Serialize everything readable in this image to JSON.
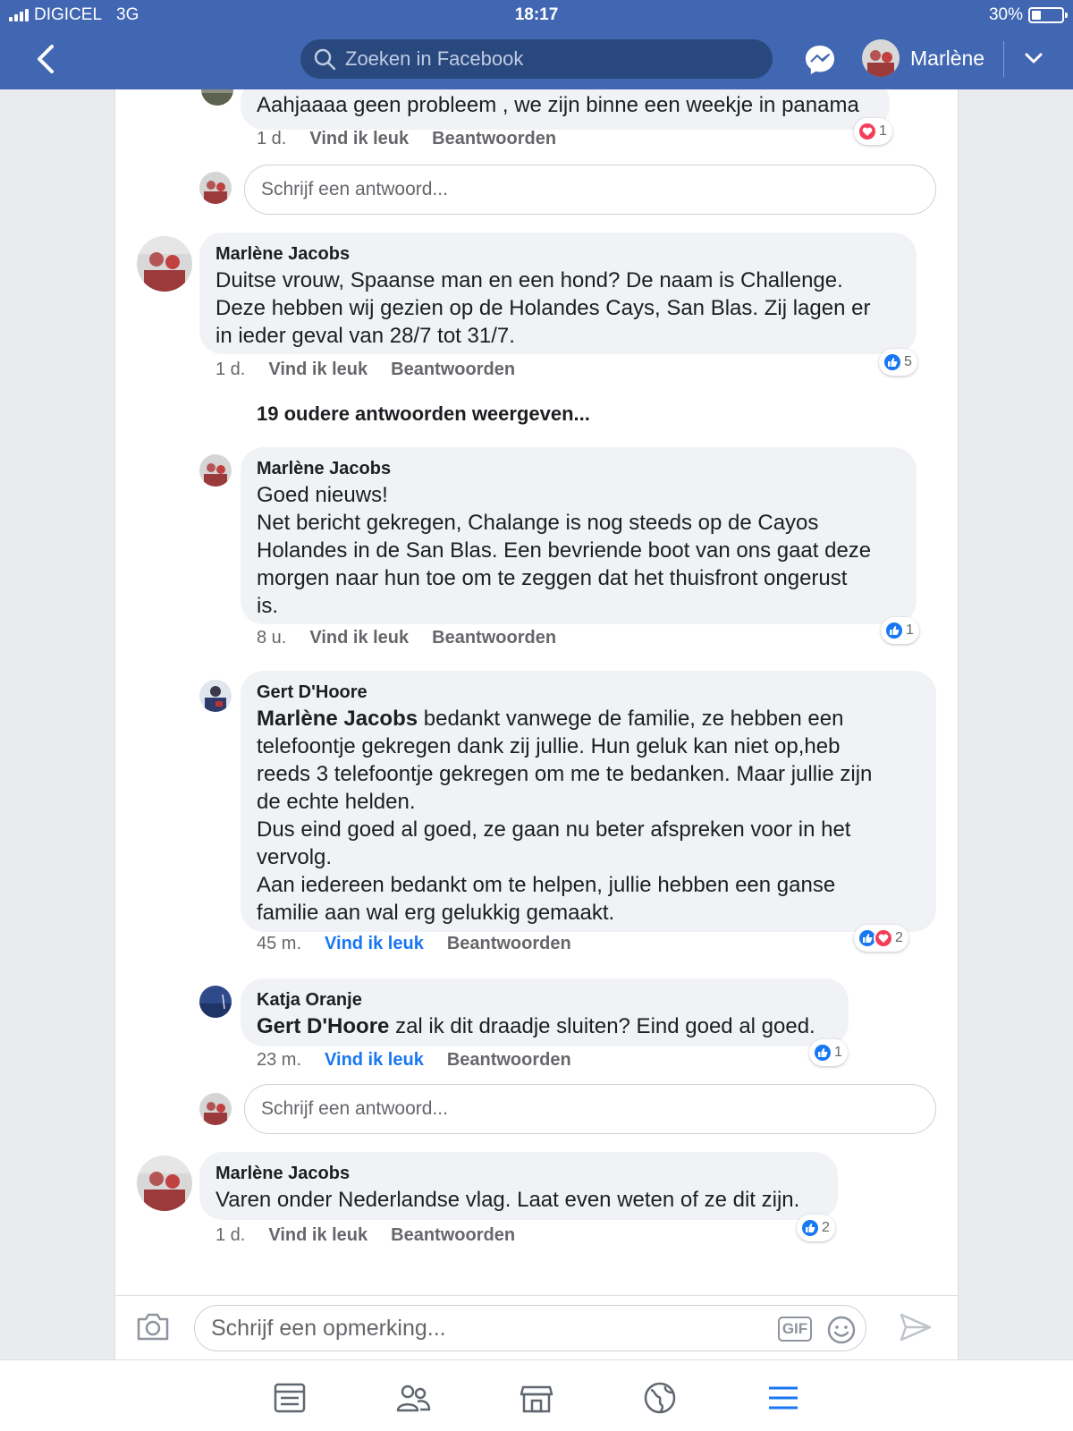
{
  "status_bar": {
    "carrier": "DIGICEL",
    "network": "3G",
    "time": "18:17",
    "battery": "30%",
    "battery_level": 0.3
  },
  "header": {
    "search_placeholder": "Zoeken in Facebook",
    "user_name": "Marlène"
  },
  "thread": {
    "top_reply": {
      "text": "Aahjaaaa geen probleem , we zijn binne een weekje in panama",
      "time": "1 d.",
      "like": "Vind ik leuk",
      "reply": "Beantwoorden",
      "reaction_count": "1"
    },
    "reply_placeholder": "Schrijf een antwoord...",
    "comment1": {
      "author": "Marlène Jacobs",
      "lines": [
        "Duitse vrouw, Spaanse man en een hond? De naam is Challenge.",
        "Deze hebben wij gezien op de Holandes Cays, San Blas. Zij lagen er",
        "in ieder geval van 28/7 tot 31/7."
      ],
      "time": "1 d.",
      "like": "Vind ik leuk",
      "reply": "Beantwoorden",
      "reaction_count": "5"
    },
    "older_replies": "19 oudere antwoorden weergeven...",
    "reply1": {
      "author": "Marlène Jacobs",
      "lines": [
        "Goed nieuws!",
        "Net bericht gekregen, Chalange is nog steeds op de Cayos",
        "Holandes in de San Blas. Een bevriende boot van ons gaat deze",
        "morgen naar hun toe om te zeggen dat het thuisfront ongerust",
        "is."
      ],
      "time": "8 u.",
      "like": "Vind ik leuk",
      "reply": "Beantwoorden",
      "reaction_count": "1"
    },
    "reply2": {
      "author": "Gert D'Hoore",
      "mention": "Marlène Jacobs",
      "first_line_rest": " bedankt vanwege de familie, ze hebben een",
      "lines": [
        "telefoontje gekregen dank zij jullie. Hun geluk kan niet op,heb",
        "reeds 3 telefoontje gekregen om me te bedanken. Maar jullie zijn",
        "de echte helden.",
        "Dus eind goed al goed, ze gaan nu beter afspreken voor in het",
        "vervolg.",
        "Aan iedereen bedankt om te helpen, jullie hebben een ganse",
        "familie aan wal erg gelukkig gemaakt."
      ],
      "time": "45 m.",
      "like": "Vind ik leuk",
      "reply": "Beantwoorden",
      "reaction_count": "2"
    },
    "reply3": {
      "author": "Katja Oranje",
      "mention": "Gert D'Hoore",
      "rest": " zal ik dit draadje sluiten? Eind goed al goed.",
      "time": "23 m.",
      "like": "Vind ik leuk",
      "reply": "Beantwoorden",
      "reaction_count": "1"
    },
    "comment2": {
      "author": "Marlène Jacobs",
      "text": "Varen onder Nederlandse vlag. Laat even weten of ze dit zijn.",
      "time": "1 d.",
      "like": "Vind ik leuk",
      "reply": "Beantwoorden",
      "reaction_count": "2"
    }
  },
  "composer": {
    "placeholder": "Schrijf een opmerking...",
    "gif_label": "GIF"
  },
  "colors": {
    "brand": "#4267b2",
    "like_blue": "#1877f2",
    "love_red": "#f33e58"
  },
  "icons": [
    "back-arrow-icon",
    "search-icon",
    "messenger-icon",
    "chevron-down-icon",
    "camera-icon",
    "emoji-icon",
    "send-icon",
    "news-feed-icon",
    "friends-icon",
    "marketplace-icon",
    "globe-icon",
    "menu-icon"
  ]
}
